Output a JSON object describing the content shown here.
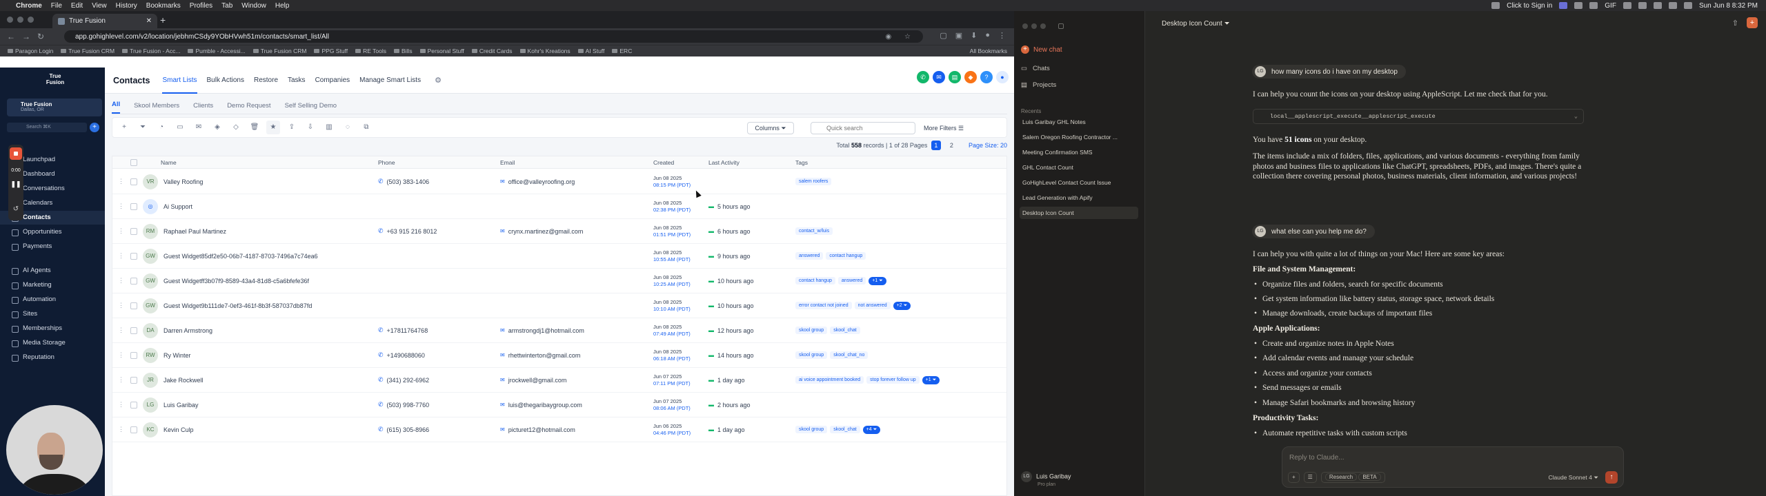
{
  "macbar": {
    "app": "Chrome",
    "menus": [
      "File",
      "Edit",
      "View",
      "History",
      "Bookmarks",
      "Profiles",
      "Tab",
      "Window",
      "Help"
    ],
    "right_text": "Click to Sign in",
    "gif": "GIF",
    "datetime": "Sun Jun 8  8:32 PM"
  },
  "browser": {
    "tab_title": "True Fusion",
    "url": "app.gohighlevel.com/v2/location/jebhmCSdy9YObHVwh51m/contacts/smart_list/All",
    "bookmarks": [
      "Paragon Login",
      "True Fusion CRM",
      "True Fusion - Acc...",
      "Pumble - Accessi...",
      "True Fusion CRM",
      "PPG Stuff",
      "RE Tools",
      "Bills",
      "Personal Stuff",
      "Credit Cards",
      "Kohr's Kreations",
      "AI Stuff",
      "ERC"
    ],
    "all_bookmarks": "All Bookmarks"
  },
  "sidebar": {
    "logo": "True Fusion",
    "account_name": "True Fusion",
    "account_loc": "Dallas, OR",
    "search": "Search",
    "shortcut": "⌘K",
    "items": [
      {
        "label": "Launchpad"
      },
      {
        "label": "Dashboard"
      },
      {
        "label": "Conversations"
      },
      {
        "label": "Calendars"
      },
      {
        "label": "Contacts"
      },
      {
        "label": "Opportunities"
      },
      {
        "label": "Payments"
      },
      {
        "label": "AI Agents"
      },
      {
        "label": "Marketing"
      },
      {
        "label": "Automation"
      },
      {
        "label": "Sites"
      },
      {
        "label": "Memberships"
      },
      {
        "label": "Media Storage"
      },
      {
        "label": "Reputation"
      }
    ],
    "recorder": {
      "time": "0:00"
    }
  },
  "contacts": {
    "title": "Contacts",
    "nav": [
      "Smart Lists",
      "Bulk Actions",
      "Restore",
      "Tasks",
      "Companies",
      "Manage Smart Lists"
    ],
    "lists": [
      "All",
      "Skool Members",
      "Clients",
      "Demo Request",
      "Self Selling Demo"
    ],
    "columns_btn": "Columns",
    "search_placeholder": "Quick search",
    "more_filters": "More Filters",
    "total": "Total",
    "total_count": "558",
    "total_suffix": "records | 1 of 28 Pages",
    "page_current": "1",
    "page_next": "2",
    "page_size": "Page Size: 20",
    "headers": {
      "name": "Name",
      "phone": "Phone",
      "email": "Email",
      "created": "Created",
      "activity": "Last Activity",
      "tags": "Tags"
    },
    "rows": [
      {
        "i": "VR",
        "name": "Valley Roofing",
        "phone": "(503) 383-1406",
        "email": "office@valleyroofing.org",
        "cd": "Jun 08 2025",
        "ct": "08:15 PM (PDT)",
        "act": "",
        "tags": [
          "salem roofers"
        ],
        "more": ""
      },
      {
        "i": "",
        "name": "Ai Support",
        "phone": "",
        "email": "",
        "cd": "Jun 08 2025",
        "ct": "02:38 PM (PDT)",
        "act": "5 hours ago",
        "tags": [],
        "more": ""
      },
      {
        "i": "RM",
        "name": "Raphael Paul Martinez",
        "phone": "+63 915 216 8012",
        "email": "crynx.martinez@gmail.com",
        "cd": "Jun 08 2025",
        "ct": "01:51 PM (PDT)",
        "act": "6 hours ago",
        "tags": [
          "contact_w/luis"
        ],
        "more": ""
      },
      {
        "i": "GW",
        "name": "Guest Widget85df2e50-06b7-4187-8703-7496a7c74ea6",
        "phone": "",
        "email": "",
        "cd": "Jun 08 2025",
        "ct": "10:55 AM (PDT)",
        "act": "9 hours ago",
        "tags": [
          "answered",
          "contact hangup"
        ],
        "more": ""
      },
      {
        "i": "GW",
        "name": "Guest Widgetff3b07f9-8589-43a4-81d8-c5a6bfefe36f",
        "phone": "",
        "email": "",
        "cd": "Jun 08 2025",
        "ct": "10:25 AM (PDT)",
        "act": "10 hours ago",
        "tags": [
          "contact hangup",
          "answered"
        ],
        "more": "+1"
      },
      {
        "i": "GW",
        "name": "Guest Widget9b111de7-0ef3-461f-8b3f-587037db87fd",
        "phone": "",
        "email": "",
        "cd": "Jun 08 2025",
        "ct": "10:10 AM (PDT)",
        "act": "10 hours ago",
        "tags": [
          "error contact not joined",
          "not answered"
        ],
        "more": "+2"
      },
      {
        "i": "DA",
        "name": "Darren Armstrong",
        "phone": "+17811764768",
        "email": "armstrongdj1@hotmail.com",
        "cd": "Jun 08 2025",
        "ct": "07:49 AM (PDT)",
        "act": "12 hours ago",
        "tags": [
          "skool group",
          "skool_chat"
        ],
        "more": ""
      },
      {
        "i": "RW",
        "name": "Ry Winter",
        "phone": "+1490688060",
        "email": "rhettwinterton@gmail.com",
        "cd": "Jun 08 2025",
        "ct": "06:18 AM (PDT)",
        "act": "14 hours ago",
        "tags": [
          "skool group",
          "skool_chat_no"
        ],
        "more": ""
      },
      {
        "i": "JR",
        "name": "Jake Rockwell",
        "phone": "(341) 292-6962",
        "email": "jrockwell@gmail.com",
        "cd": "Jun 07 2025",
        "ct": "07:11 PM (PDT)",
        "act": "1 day ago",
        "tags": [
          "ai voice appointment booked",
          "stop forever follow up"
        ],
        "more": "+1"
      },
      {
        "i": "LG",
        "name": "Luis Garibay",
        "phone": "(503) 998-7760",
        "email": "luis@thegaribaygroup.com",
        "cd": "Jun 07 2025",
        "ct": "08:06 AM (PDT)",
        "act": "2 hours ago",
        "tags": [],
        "more": ""
      },
      {
        "i": "KC",
        "name": "Kevin Culp",
        "phone": "(615) 305-8966",
        "email": "picturet12@hotmail.com",
        "cd": "Jun 06 2025",
        "ct": "04:46 PM (PDT)",
        "act": "1 day ago",
        "tags": [
          "skool group",
          "skool_chat"
        ],
        "more": "+4"
      }
    ]
  },
  "claude": {
    "new_chat": "New chat",
    "nav": [
      "Chats",
      "Projects"
    ],
    "recents_label": "Recents",
    "recents": [
      "Luis Garibay GHL Notes",
      "Salem Oregon Roofing Contractor ...",
      "Meeting Confirmation SMS",
      "GHL Contact Count",
      "GoHighLevel Contact Count Issue",
      "Lead Generation with Apify",
      "Desktop Icon Count"
    ],
    "user": "Luis Garibay",
    "plan": "Pro plan",
    "user_initials": "LG",
    "conv_title": "Desktop Icon Count",
    "share": "Share",
    "msg1": "how many icons do i have on my desktop",
    "reply1": "I can help you count the icons on your desktop using AppleScript. Let me check that for you.",
    "tool": "local__applescript_execute__applescript_execute",
    "you_have_pre": "You have",
    "you_have_count": "51 icons",
    "you_have_post": "on your desktop.",
    "items_para": "The items include a mix of folders, files, applications, and various documents - everything from family photos and business files to applications like ChatGPT, spreadsheets, PDFs, and images. There's quite a collection there covering personal photos, business materials, client information, and various projects!",
    "msg2": "what else can you help me do?",
    "reply2": "I can help you with quite a lot of things on your Mac! Here are some key areas:",
    "h1": "File and System Management:",
    "b1": [
      "Organize files and folders, search for specific documents",
      "Get system information like battery status, storage space, network details",
      "Manage downloads, create backups of important files"
    ],
    "h2": "Apple Applications:",
    "b2": [
      "Create and organize notes in Apple Notes",
      "Add calendar events and manage your schedule",
      "Access and organize your contacts",
      "Send messages or emails",
      "Manage Safari bookmarks and browsing history"
    ],
    "h3": "Productivity Tasks:",
    "b3": [
      "Automate repetitive tasks with custom scripts"
    ],
    "composer_placeholder": "Reply to Claude...",
    "research": "Research",
    "beta": "BETA",
    "model": "Claude Sonnet 4"
  }
}
